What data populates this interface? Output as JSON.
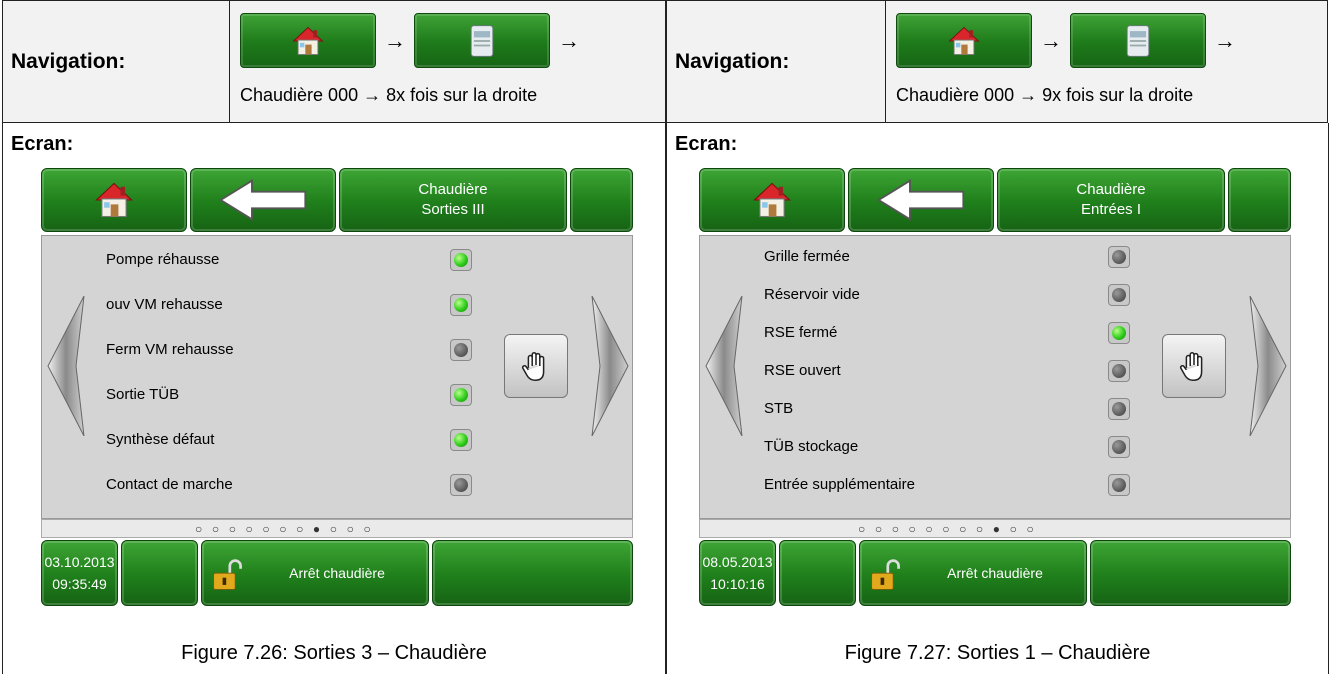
{
  "left": {
    "nav_label": "Navigation:",
    "nav_path": "Chaudière 000 → 8x fois sur la droite",
    "nav_arrow": "→",
    "screen_label": "Ecran:",
    "device": {
      "title_line1": "Chaudière",
      "title_line2": "Sorties III",
      "rows": [
        {
          "label": "Pompe réhausse",
          "state": "on"
        },
        {
          "label": "ouv VM rehausse",
          "state": "on"
        },
        {
          "label": "Ferm VM rehausse",
          "state": "off"
        },
        {
          "label": "Sortie TÜB",
          "state": "on"
        },
        {
          "label": "Synthèse défaut",
          "state": "on"
        },
        {
          "label": "Contact de marche",
          "state": "off"
        }
      ],
      "page_dots": "○○○○○○○●○○○",
      "date": "03.10.2013",
      "time": "09:35:49",
      "status": "Arrêt chaudière"
    },
    "caption": "Figure 7.26: Sorties 3 – Chaudière"
  },
  "right": {
    "nav_label": "Navigation:",
    "nav_path": "Chaudière 000 → 9x fois sur la droite",
    "nav_arrow": "→",
    "screen_label": "Ecran:",
    "device": {
      "title_line1": "Chaudière",
      "title_line2": "Entrées I",
      "rows": [
        {
          "label": "Grille fermée",
          "state": "off"
        },
        {
          "label": "Réservoir vide",
          "state": "off"
        },
        {
          "label": "RSE fermé",
          "state": "on"
        },
        {
          "label": "RSE ouvert",
          "state": "off"
        },
        {
          "label": "STB",
          "state": "off"
        },
        {
          "label": "TÜB stockage",
          "state": "off"
        },
        {
          "label": "Entrée supplémentaire",
          "state": "off"
        }
      ],
      "page_dots": "○○○○○○○○●○○",
      "date": "08.05.2013",
      "time": "10:10:16",
      "status": "Arrêt chaudière"
    },
    "caption": "Figure 7.27: Sorties 1 – Chaudière"
  },
  "icons": {
    "home": "house-icon",
    "boiler": "boiler-icon",
    "back": "back-arrow-icon",
    "hand": "hand-icon",
    "lock": "padlock-open-icon",
    "prev": "chevron-left-icon",
    "next": "chevron-right-icon"
  },
  "colors": {
    "button_green": "#1f7f1b",
    "led_on": "#2ecc1a",
    "led_off": "#5e5e5e",
    "panel_gray": "#d4d4d4"
  }
}
